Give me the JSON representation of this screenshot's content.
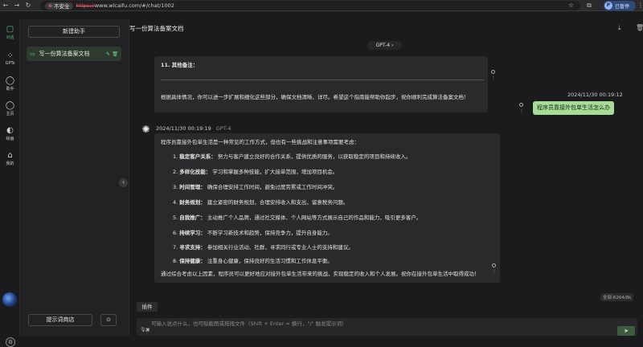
{
  "browser": {
    "insecure_label": "不安全",
    "url_scheme": "https://",
    "url_rest": "www.wlcaifu.com/#/chat/1002",
    "profile_initial": "P",
    "profile_status": "已暂停"
  },
  "rail": {
    "items": [
      {
        "icon": "chat-bubble-icon",
        "glyph": "💬",
        "label": "对话"
      },
      {
        "icon": "grid-icon",
        "glyph": "▦",
        "label": "GPTs"
      },
      {
        "icon": "assistant-icon",
        "glyph": "◯",
        "label": "助手"
      },
      {
        "icon": "home-bubble-icon",
        "glyph": "◯",
        "label": "主页"
      },
      {
        "icon": "palette-icon",
        "glyph": "◐",
        "label": "绘画"
      },
      {
        "icon": "house-icon",
        "glyph": "⌂",
        "label": "我的"
      }
    ]
  },
  "sidebar": {
    "new_button": "新建助手",
    "chat_item": "写一份算法备案文档",
    "prompt_shop": "提示词商店"
  },
  "header": {
    "title": "写一份算法备案文档"
  },
  "model_selector": "GPT-4",
  "messages": {
    "prev_ai": {
      "heading": "11. 其他备注：",
      "text": "根据具体情况，你可以进一步扩展和细化这些部分，确保文档清晰、详尽。希望这个指南能帮助你起步，祝你顺利完成算法备案文档！"
    },
    "user": {
      "timestamp": "2024/11/30 00:19:12",
      "text": "程序员靠接外包单生活怎么办"
    },
    "ai": {
      "timestamp": "2024/11/30 00:19:19",
      "model": "GPT-4",
      "intro": "程序员靠接外包单生活是一种常见的工作方式，但也有一些挑战和注意事项需要考虑：",
      "items": [
        {
          "num": "1.",
          "title": "稳定客户关系",
          "text": "努力与客户建立良好的合作关系，提供优质的服务，以获取稳定的项目和持续收入。"
        },
        {
          "num": "2.",
          "title": "多样化技能",
          "text": "学习和掌握多种技能，扩大接单范围，增加项目机会。"
        },
        {
          "num": "3.",
          "title": "时间管理",
          "text": "确保合理安排工作时间，避免过度劳累或工作时间冲突。"
        },
        {
          "num": "4.",
          "title": "财务规划",
          "text": "建立紧密的财务规划，合理安排收入和支出，留意税务问题。"
        },
        {
          "num": "5.",
          "title": "自我推广",
          "text": "主动推广个人品牌，通过社交媒体、个人网站等方式展示自己的作品和能力，吸引更多客户。"
        },
        {
          "num": "6.",
          "title": "持续学习",
          "text": "不断学习新技术和趋势，保持竞争力，提升自身能力。"
        },
        {
          "num": "7.",
          "title": "寻求支持",
          "text": "参加相关行业活动、社群，寻求同行或专业人士的支持和建议。"
        },
        {
          "num": "8.",
          "title": "保持健康",
          "text": "注重身心健康，保持良好的生活习惯和工作休息平衡。"
        }
      ],
      "outro": "通过综合考虑以上因素，程序员可以更好地应对接外包单生活带来的挑战，实现稳定的收入和个人发展。祝你在接外包单生活中取得成功！"
    }
  },
  "input": {
    "token_info": "全部:6264/8k",
    "plugin_label": "插件",
    "placeholder": "可输入说点什么，也可贴截图或拖拽文件（Shift + Enter = 换行，\"/\" 触发提示词）"
  },
  "colors": {
    "accent_green": "#4ec172",
    "user_bubble": "#a5dd97",
    "background": "#1b1b1d"
  }
}
